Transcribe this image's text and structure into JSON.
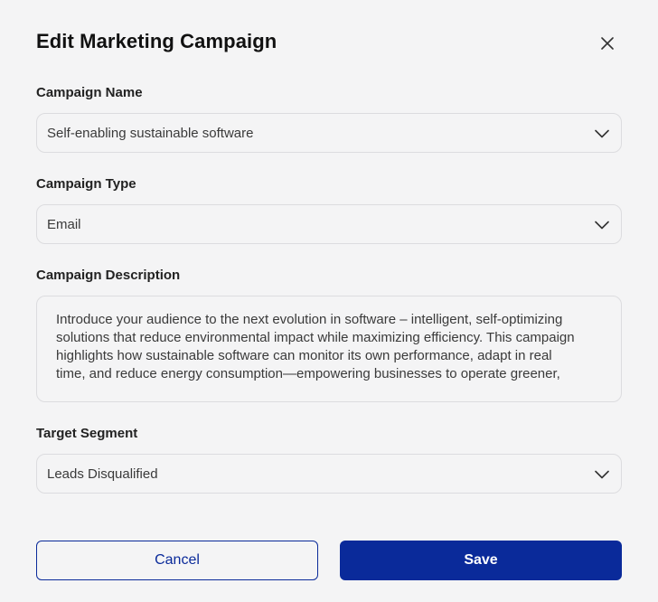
{
  "colors": {
    "accent": "#0a2a9a",
    "background": "#f4f4f5",
    "border": "#dcdcdf"
  },
  "modal": {
    "title": "Edit Marketing Campaign",
    "close_icon": "close-icon"
  },
  "fields": {
    "campaign_name": {
      "label": "Campaign Name",
      "value": "Self-enabling sustainable software"
    },
    "campaign_type": {
      "label": "Campaign Type",
      "value": "Email"
    },
    "campaign_description": {
      "label": "Campaign Description",
      "value": "Introduce your audience to the next evolution in software – intelligent, self-optimizing solutions that reduce environmental impact while maximizing efficiency. This campaign highlights how sustainable software can monitor its own performance, adapt in real time, and reduce energy consumption—empowering businesses to operate greener, smarter,"
    },
    "target_segment": {
      "label": "Target Segment",
      "value": "Leads Disqualified"
    }
  },
  "buttons": {
    "cancel_label": "Cancel",
    "save_label": "Save"
  }
}
